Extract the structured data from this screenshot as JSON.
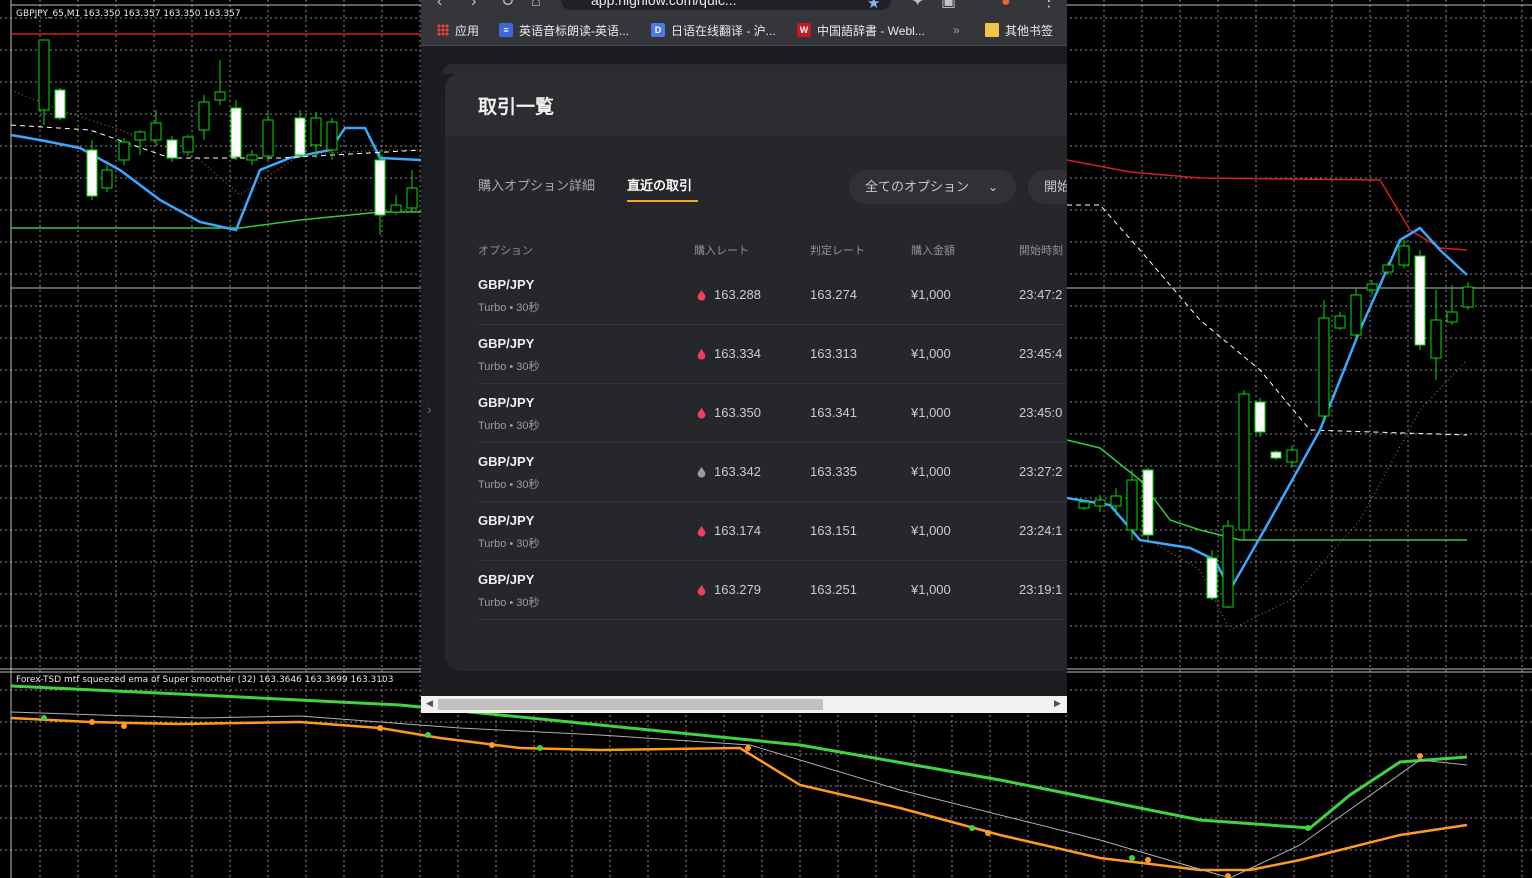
{
  "chart": {
    "title": "GBPJPY_65,M1  163.350 163.357 163.350 163.357",
    "indicator_title": "Forex-TSD mtf squeezed ema of Super smoother (32) 163.3646 163.3699 163.3103",
    "colors": {
      "grid": "#8a8a8a",
      "bull": "#00e000",
      "bear_fill": "#ffffff",
      "ema_blue": "#3aa8ff",
      "band_red": "#d42020",
      "band_green": "#2ecc40",
      "smoother_orange": "#ff9a1f",
      "smoother_green": "#3fd43f"
    }
  },
  "browser": {
    "address": "app.highlow.com/quic...",
    "bookmarks": [
      {
        "icon": "apps-grid-icon",
        "label": "应用"
      },
      {
        "icon": "dict-icon",
        "label": "英语音标朗读-英语..."
      },
      {
        "icon": "d-icon",
        "label": "日语在线翻译 - 沪..."
      },
      {
        "icon": "w-icon",
        "label": "中国語辞書 - Webl..."
      },
      {
        "icon": "more-icon",
        "label": "»"
      },
      {
        "icon": "folder-icon",
        "label": "其他书签"
      }
    ]
  },
  "modal": {
    "title": "取引一覧",
    "tabs": [
      {
        "label": "購入オプション詳細",
        "active": false
      },
      {
        "label": "直近の取引",
        "active": true
      }
    ],
    "filter_label": "全てのオプション",
    "filter2_label": "開始",
    "columns": [
      "オプション",
      "購入レート",
      "判定レート",
      "購入金額",
      "開始時刻"
    ],
    "rows": [
      {
        "pair": "GBP/JPY",
        "sub": "Turbo • 30秒",
        "buy_rate": "163.288",
        "judge_rate": "163.274",
        "amount": "¥1,000",
        "start": "23:47:2",
        "status": "loss"
      },
      {
        "pair": "GBP/JPY",
        "sub": "Turbo • 30秒",
        "buy_rate": "163.334",
        "judge_rate": "163.313",
        "amount": "¥1,000",
        "start": "23:45:4",
        "status": "loss"
      },
      {
        "pair": "GBP/JPY",
        "sub": "Turbo • 30秒",
        "buy_rate": "163.350",
        "judge_rate": "163.341",
        "amount": "¥1,000",
        "start": "23:45:0",
        "status": "loss"
      },
      {
        "pair": "GBP/JPY",
        "sub": "Turbo • 30秒",
        "buy_rate": "163.342",
        "judge_rate": "163.335",
        "amount": "¥1,000",
        "start": "23:27:2",
        "status": "neutral"
      },
      {
        "pair": "GBP/JPY",
        "sub": "Turbo • 30秒",
        "buy_rate": "163.174",
        "judge_rate": "163.151",
        "amount": "¥1,000",
        "start": "23:24:1",
        "status": "loss"
      },
      {
        "pair": "GBP/JPY",
        "sub": "Turbo • 30秒",
        "buy_rate": "163.279",
        "judge_rate": "163.251",
        "amount": "¥1,000",
        "start": "23:19:1",
        "status": "loss"
      }
    ],
    "status_colors": {
      "loss": "#f0405a",
      "neutral": "#9a9ca1"
    }
  }
}
